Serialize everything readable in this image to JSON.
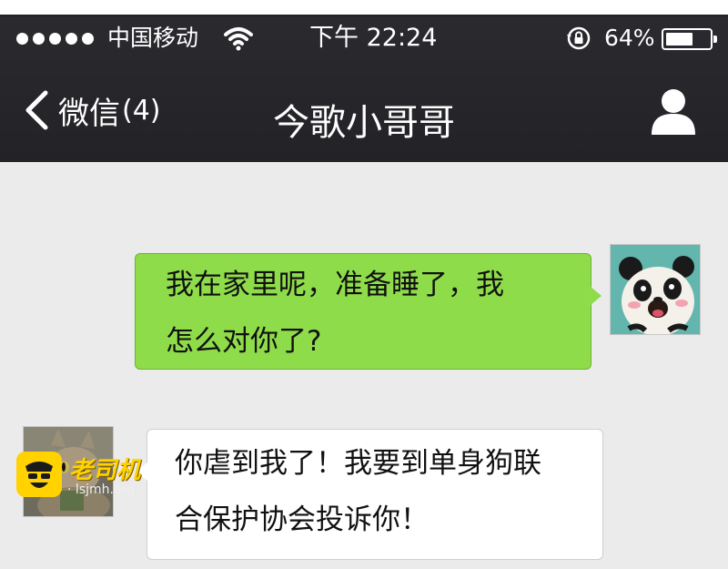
{
  "status_bar": {
    "carrier": "中国移动",
    "time": "下午 22:24",
    "battery_percent": "64%",
    "battery_level": 0.64,
    "icons": [
      "signal-dots-icon",
      "wifi-icon",
      "rotation-lock-icon",
      "battery-icon"
    ]
  },
  "nav": {
    "back_label": "微信",
    "unread_count": "(4)",
    "title": "今歌小哥哥",
    "profile_icon": "person-icon"
  },
  "messages": [
    {
      "from": "me",
      "lines": [
        "我在家里呢，准备睡了，我",
        "怎么对你了?"
      ],
      "avatar": "panda-avatar"
    },
    {
      "from": "other",
      "lines": [
        "你虐到我了！我要到单身狗联",
        "合保护协会投诉你！"
      ],
      "avatar": "cat-avatar"
    }
  ],
  "watermark": {
    "brand": "老司机",
    "url": "· lsjmh.org ·"
  },
  "colors": {
    "header_bg": "#2b2a2f",
    "chat_bg": "#ebebeb",
    "outgoing_bubble": "#8fdc4a",
    "incoming_bubble": "#ffffff"
  }
}
